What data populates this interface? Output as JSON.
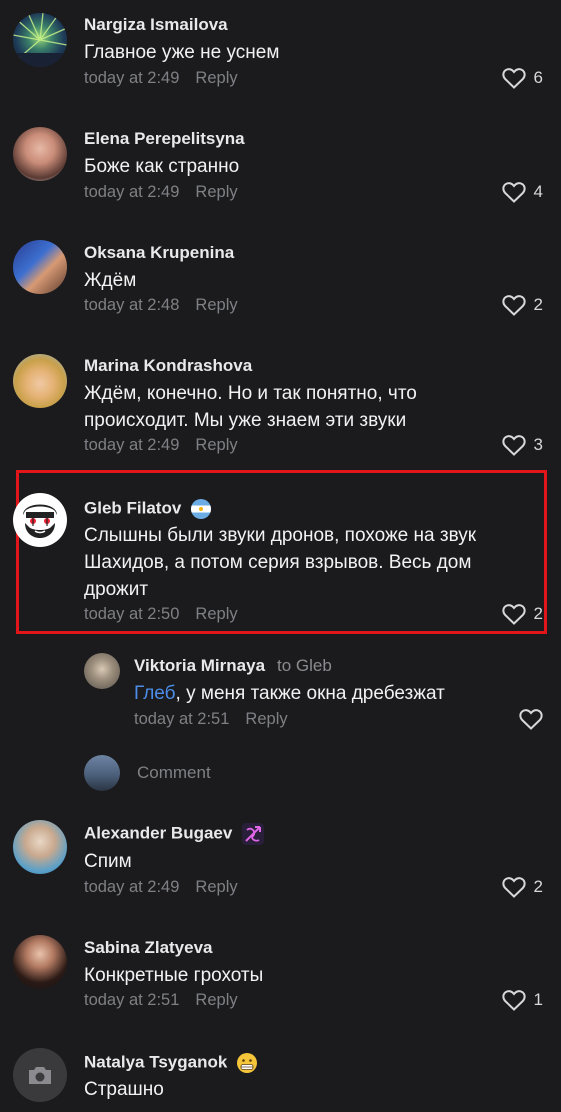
{
  "comments": [
    {
      "name": "Nargiza Ismailova",
      "text": "Главное уже не уснем",
      "time": "today at 2:49",
      "reply": "Reply",
      "likes": "6"
    },
    {
      "name": "Elena Perepelitsyna",
      "text": "Боже как странно",
      "time": "today at 2:49",
      "reply": "Reply",
      "likes": "4"
    },
    {
      "name": "Oksana Krupenina",
      "text": "Ждём",
      "time": "today at 2:48",
      "reply": "Reply",
      "likes": "2"
    },
    {
      "name": "Marina Kondrashova",
      "text_line1": "Ждём,  конечно.  Но и так понятно, что",
      "text_line2": "происходит. Мы уже знаем эти звуки",
      "time": "today at 2:49",
      "reply": "Reply",
      "likes": "3"
    },
    {
      "name": "Gleb Filatov",
      "text_line1": "Слышны были звуки дронов, похоже на звук",
      "text_line2": "Шахидов, а потом серия взрывов. Весь дом",
      "text_line3": "дрожит",
      "time": "today at 2:50",
      "reply": "Reply",
      "likes": "2"
    },
    {
      "name": "Alexander Bugaev",
      "text": "Спим",
      "time": "today at 2:49",
      "reply": "Reply",
      "likes": "2"
    },
    {
      "name": "Sabina Zlatyeva",
      "text": "Конкретные грохоты",
      "time": "today at 2:51",
      "reply": "Reply",
      "likes": "1"
    },
    {
      "name": "Natalya Tsyganok",
      "text": "Страшно"
    }
  ],
  "reply_thread": {
    "name": "Viktoria Mirnaya",
    "to": "to Gleb",
    "mention": "Глеб",
    "text": ", у меня также окна дребезжат",
    "time": "today at 2:51",
    "reply": "Reply",
    "comment_placeholder": "Comment"
  },
  "colors": {
    "background": "#1b1b1d",
    "highlight_border": "#e1151a",
    "mention": "#4c8dea",
    "meta": "#7f8085"
  },
  "icons": [
    "heart-icon",
    "camera-icon",
    "argentina-flag-icon",
    "bow-arrow-icon",
    "grimacing-emoji-icon"
  ]
}
